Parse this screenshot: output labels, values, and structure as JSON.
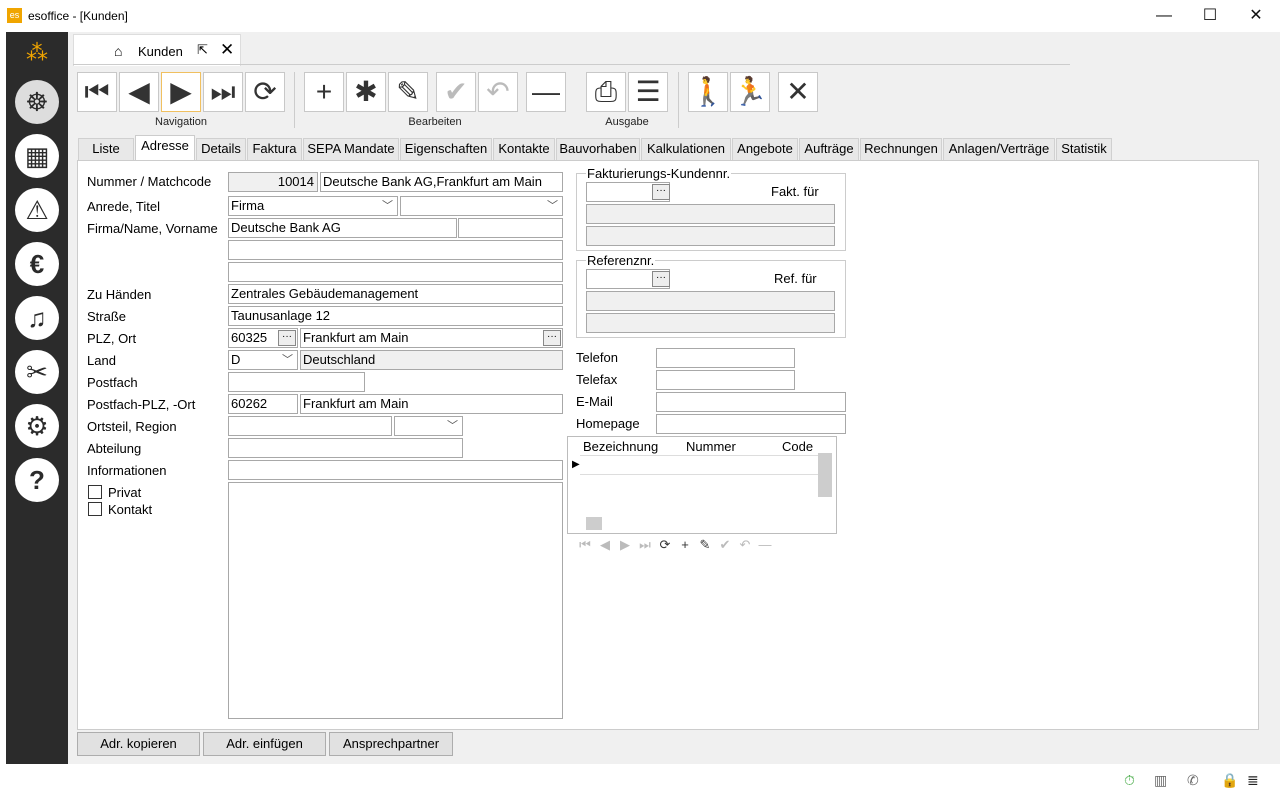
{
  "window": {
    "title": "esoffice - [Kunden]",
    "app_icon": "es"
  },
  "doc_tab": {
    "label": "Kunden"
  },
  "toolbar": {
    "groups": {
      "navigation": "Navigation",
      "edit": "Bearbeiten",
      "output": "Ausgabe"
    }
  },
  "tabs": [
    "Liste",
    "Adresse",
    "Details",
    "Faktura",
    "SEPA Mandate",
    "Eigenschaften",
    "Kontakte",
    "Bauvorhaben",
    "Kalkulationen",
    "Angebote",
    "Aufträge",
    "Rechnungen",
    "Anlagen/Verträge",
    "Statistik"
  ],
  "form": {
    "labels": {
      "nummer": "Nummer / Matchcode",
      "anrede": "Anrede, Titel",
      "firma": "Firma/Name, Vorname",
      "zuhaenden": "Zu Händen",
      "strasse": "Straße",
      "plzort": "PLZ, Ort",
      "land": "Land",
      "postfach": "Postfach",
      "pfplz": "Postfach-PLZ, -Ort",
      "ortsteil": "Ortsteil, Region",
      "abteilung": "Abteilung",
      "informationen": "Informationen",
      "privat": "Privat",
      "kontakt": "Kontakt"
    },
    "values": {
      "nummer": "10014",
      "matchcode": "Deutsche Bank AG,Frankfurt am Main",
      "anrede": "Firma",
      "titel": "",
      "firma": "Deutsche Bank AG",
      "vorname": "",
      "zuhaenden": "Zentrales Gebäudemanagement",
      "strasse": "Taunusanlage 12",
      "plz": "60325",
      "ort": "Frankfurt am Main",
      "land_code": "D",
      "land_name": "Deutschland",
      "postfach": "",
      "pf_plz": "60262",
      "pf_ort": "Frankfurt am Main",
      "ortsteil": "",
      "abteilung": "",
      "informationen": ""
    }
  },
  "right": {
    "fakt_group": "Fakturierungs-Kundennr.",
    "fakt_label": "Fakt. für",
    "ref_group": "Referenznr.",
    "ref_label": "Ref. für",
    "telefon": "Telefon",
    "telefax": "Telefax",
    "email": "E-Mail",
    "homepage": "Homepage",
    "grid_columns": [
      "Bezeichnung",
      "Nummer",
      "Code"
    ]
  },
  "bottom_buttons": {
    "copy": "Adr. kopieren",
    "paste": "Adr. einfügen",
    "contact": "Ansprechpartner"
  }
}
